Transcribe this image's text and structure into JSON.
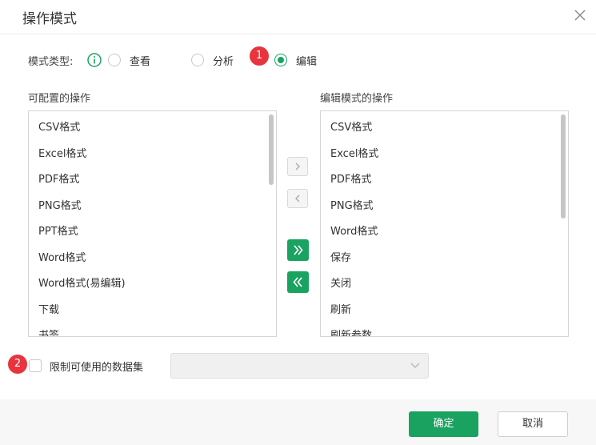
{
  "dialog": {
    "title": "操作模式"
  },
  "mode": {
    "label": "模式类型:",
    "options": [
      {
        "label": "查看",
        "checked": false
      },
      {
        "label": "分析",
        "checked": false
      },
      {
        "label": "编辑",
        "checked": true
      }
    ]
  },
  "badges": [
    "1",
    "2"
  ],
  "available": {
    "title": "可配置的操作",
    "items": [
      "CSV格式",
      "Excel格式",
      "PDF格式",
      "PNG格式",
      "PPT格式",
      "Word格式",
      "Word格式(易编辑)",
      "下载",
      "书签"
    ]
  },
  "edit_mode": {
    "title": "编辑模式的操作",
    "items": [
      "CSV格式",
      "Excel格式",
      "PDF格式",
      "PNG格式",
      "Word格式",
      "保存",
      "关闭",
      "刷新",
      "刷新参数"
    ]
  },
  "transfer": {
    "move_right": "›",
    "move_left": "‹",
    "move_all_right": "»",
    "move_all_left": "«"
  },
  "restrict": {
    "label": "限制可使用的数据集",
    "checked": false,
    "select_value": ""
  },
  "footer": {
    "ok_label": "确定",
    "cancel_label": "取消"
  },
  "colors": {
    "accent": "#1aa260",
    "badge": "#e8343d"
  }
}
